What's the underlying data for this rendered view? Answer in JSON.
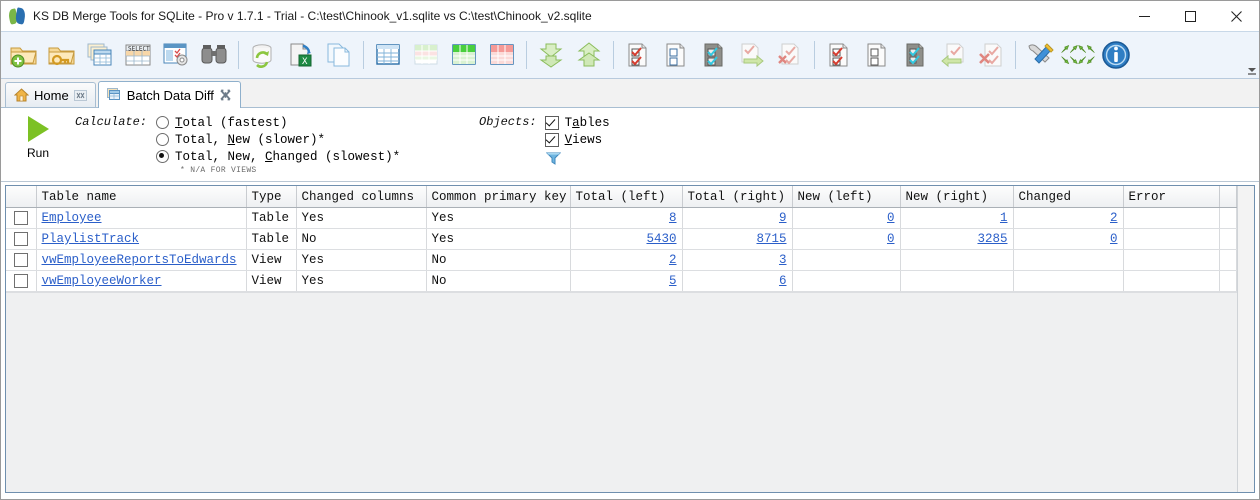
{
  "window": {
    "title": "KS DB Merge Tools for SQLite - Pro v 1.7.1 - Trial - C:\\test\\Chinook_v1.sqlite vs C:\\test\\Chinook_v2.sqlite",
    "app_icon": "ks-db-merge-logo-icon",
    "controls": [
      {
        "name": "minimize-button",
        "glyph": "minimize-icon"
      },
      {
        "name": "maximize-button",
        "glyph": "maximize-icon"
      },
      {
        "name": "close-button",
        "glyph": "close-icon"
      }
    ]
  },
  "toolbar": {
    "overflow_label": "toolbar-overflow-icon",
    "groups": [
      {
        "buttons": [
          {
            "name": "open-new-database-button",
            "icon": "folder-add-icon"
          },
          {
            "name": "open-database-with-credentials-button",
            "icon": "folder-key-icon"
          },
          {
            "name": "compare-schemas-button",
            "icon": "table-stack-icon"
          },
          {
            "name": "run-select-query-button",
            "icon": "select-query-table-icon"
          },
          {
            "name": "object-settings-button",
            "icon": "list-gear-icon"
          },
          {
            "name": "find-button",
            "icon": "binoculars-icon"
          }
        ]
      },
      {
        "buttons": [
          {
            "name": "refresh-database-button",
            "icon": "database-refresh-icon"
          },
          {
            "name": "export-to-excel-button",
            "icon": "document-excel-export-icon"
          },
          {
            "name": "copy-document-button",
            "icon": "copy-document-icon"
          }
        ]
      },
      {
        "buttons": [
          {
            "name": "show-all-rows-button",
            "icon": "grid-blue-icon"
          },
          {
            "name": "show-changed-rows-button",
            "icon": "grid-pale-icon"
          },
          {
            "name": "show-new-rows-button",
            "icon": "grid-green-icon"
          },
          {
            "name": "show-deleted-rows-button",
            "icon": "grid-red-icon"
          }
        ]
      },
      {
        "buttons": [
          {
            "name": "collapse-all-button",
            "icon": "arrow-down-double-icon"
          },
          {
            "name": "expand-all-button",
            "icon": "arrow-up-double-icon"
          }
        ]
      },
      {
        "buttons": [
          {
            "name": "check-all-items-button",
            "icon": "document-checked-all-icon"
          },
          {
            "name": "uncheck-all-items-button",
            "icon": "document-unchecked-icon"
          },
          {
            "name": "invert-selection-button",
            "icon": "document-invert-check-icon"
          },
          {
            "name": "apply-checked-button",
            "icon": "document-check-arrow-icon"
          },
          {
            "name": "clear-checked-button",
            "icon": "document-check-delete-icon"
          }
        ]
      },
      {
        "buttons": [
          {
            "name": "check-visible-button",
            "icon": "document-check-red-icon"
          },
          {
            "name": "uncheck-visible-button",
            "icon": "document-empty-boxes-icon"
          },
          {
            "name": "toggle-check-button",
            "icon": "document-teal-check-icon"
          },
          {
            "name": "revert-changes-button",
            "icon": "document-left-arrow-icon"
          },
          {
            "name": "discard-changes-button",
            "icon": "document-check-cross-icon"
          }
        ]
      },
      {
        "buttons": [
          {
            "name": "tools-options-button",
            "icon": "hammer-wrench-icon"
          },
          {
            "name": "navigate-buttons-group",
            "icon": "green-arrows-grid-icon"
          },
          {
            "name": "about-button",
            "icon": "info-circle-icon"
          }
        ]
      }
    ]
  },
  "tabs": [
    {
      "name": "tab-home",
      "label": "Home",
      "icon": "home-icon",
      "active": false,
      "closable": true
    },
    {
      "name": "tab-batch-data-diff",
      "label": "Batch Data Diff",
      "icon": "table-stack-icon",
      "active": true,
      "closable": true
    }
  ],
  "options": {
    "run_button_label": "Run",
    "run_icon": "play-triangle-icon",
    "calculate_label": "Calculate:",
    "calculate_options": [
      {
        "name": "radio-total",
        "label_pre": "",
        "label_mn": "T",
        "label_post": "otal (fastest)",
        "selected": false
      },
      {
        "name": "radio-total-new",
        "label_pre": "Total, ",
        "label_mn": "N",
        "label_post": "ew (slower)*",
        "selected": false
      },
      {
        "name": "radio-total-new-changed",
        "label_pre": "Total, New, ",
        "label_mn": "C",
        "label_post": "hanged (slowest)*",
        "selected": true
      }
    ],
    "footnote": "* N/A FOR VIEWS",
    "objects_label": "Objects:",
    "objects_options": [
      {
        "name": "checkbox-tables",
        "label_pre": "T",
        "label_mn": "a",
        "label_post": "bles",
        "checked": true
      },
      {
        "name": "checkbox-views",
        "label_pre": "",
        "label_mn": "V",
        "label_post": "iews",
        "checked": true
      }
    ],
    "filter_icon": "funnel-filter-icon"
  },
  "grid": {
    "columns": [
      {
        "key": "check",
        "label": ""
      },
      {
        "key": "table_name",
        "label": "Table name"
      },
      {
        "key": "type",
        "label": "Type"
      },
      {
        "key": "changed_columns",
        "label": "Changed columns"
      },
      {
        "key": "common_primary_key",
        "label": "Common primary key"
      },
      {
        "key": "total_left",
        "label": "Total (left)"
      },
      {
        "key": "total_right",
        "label": "Total (right)"
      },
      {
        "key": "new_left",
        "label": "New (left)"
      },
      {
        "key": "new_right",
        "label": "New (right)"
      },
      {
        "key": "changed",
        "label": "Changed"
      },
      {
        "key": "error",
        "label": "Error"
      },
      {
        "key": "filler",
        "label": ""
      }
    ],
    "rows": [
      {
        "checked": false,
        "table_name": "Employee",
        "type": "Table",
        "changed_columns": "Yes",
        "common_primary_key": "Yes",
        "total_left": "8",
        "total_left_bg": "pink",
        "total_right": "9",
        "total_right_bg": "pink",
        "new_left": "0",
        "new_left_bg": "white",
        "new_right": "1",
        "new_right_bg": "green",
        "changed": "2",
        "changed_bg": "pink",
        "error": ""
      },
      {
        "checked": false,
        "table_name": "PlaylistTrack",
        "type": "Table",
        "changed_columns": "No",
        "common_primary_key": "Yes",
        "total_left": "5430",
        "total_left_bg": "pink",
        "total_right": "8715",
        "total_right_bg": "pink",
        "new_left": "0",
        "new_left_bg": "white",
        "new_right": "3285",
        "new_right_bg": "green",
        "changed": "0",
        "changed_bg": "white",
        "error": ""
      },
      {
        "checked": false,
        "table_name": "vwEmployeeReportsToEdwards",
        "type": "View",
        "changed_columns": "Yes",
        "common_primary_key": "No",
        "total_left": "2",
        "total_left_bg": "pink",
        "total_right": "3",
        "total_right_bg": "pink",
        "new_left": "",
        "new_left_bg": "white",
        "new_right": "",
        "new_right_bg": "white",
        "changed": "",
        "changed_bg": "white",
        "error": ""
      },
      {
        "checked": false,
        "table_name": "vwEmployeeWorker",
        "type": "View",
        "changed_columns": "Yes",
        "common_primary_key": "No",
        "total_left": "5",
        "total_left_bg": "pink",
        "total_right": "6",
        "total_right_bg": "pink",
        "new_left": "",
        "new_left_bg": "white",
        "new_right": "",
        "new_right_bg": "white",
        "changed": "",
        "changed_bg": "white",
        "error": ""
      }
    ]
  },
  "colors": {
    "pink_cell": "#fdeeee",
    "green_cell": "#eefbe6",
    "link": "#2b5fc9",
    "toolbar_bg": "#eef4fb",
    "grid_border": "#6f8fae",
    "run_green": "#7cc124"
  }
}
